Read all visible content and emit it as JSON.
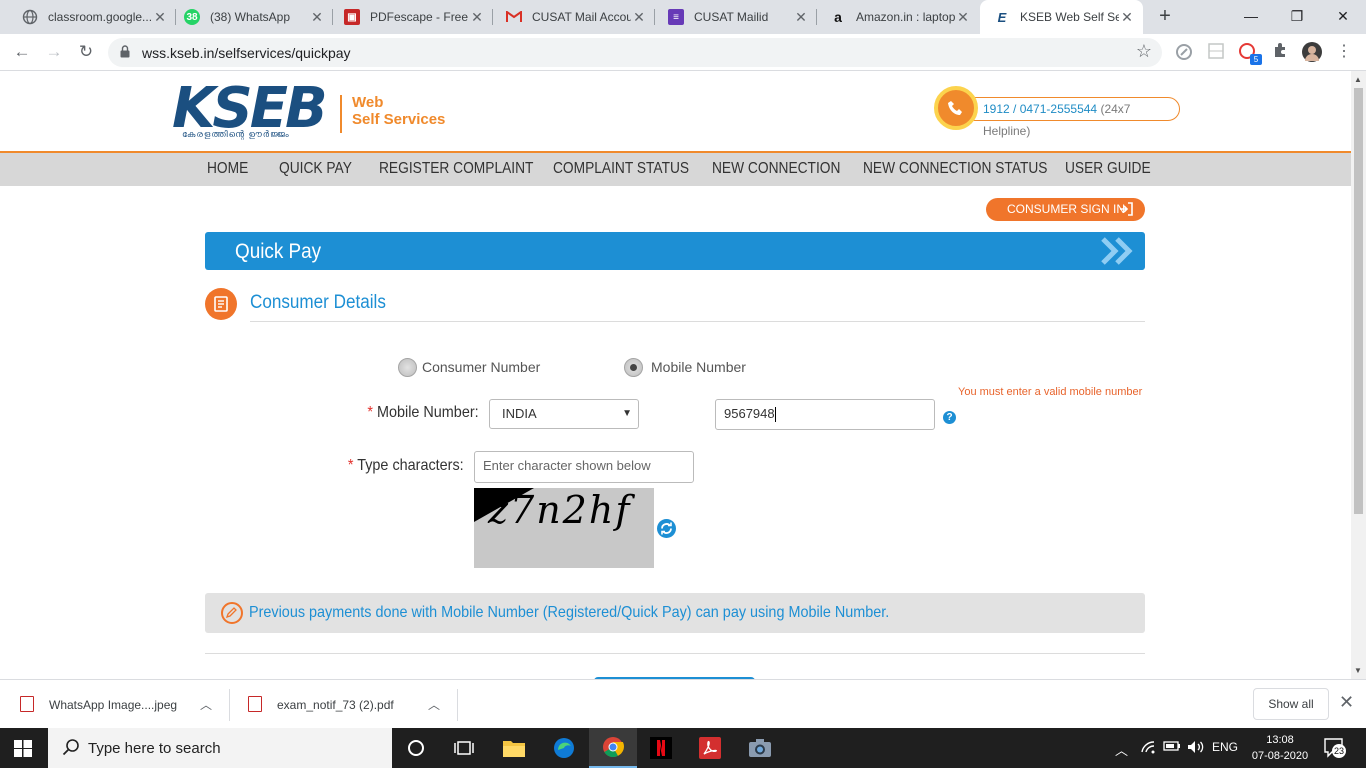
{
  "browser": {
    "tabs": [
      {
        "title": "classroom.google...",
        "icon": "globe-icon"
      },
      {
        "title": "(38) WhatsApp",
        "icon": "whatsapp-icon",
        "badge": "38"
      },
      {
        "title": "PDFescape - Free",
        "icon": "pdfescape-icon"
      },
      {
        "title": "CUSAT Mail Accou",
        "icon": "gmail-icon"
      },
      {
        "title": "CUSAT Mailid",
        "icon": "forms-icon"
      },
      {
        "title": "Amazon.in : laptop",
        "icon": "amazon-icon"
      },
      {
        "title": "KSEB Web Self Ser",
        "icon": "kseb-icon"
      }
    ],
    "url": "wss.kseb.in/selfservices/quickpay",
    "extension_badge": "5"
  },
  "header": {
    "logo_text": "KSEB",
    "logo_tagline": "കേരളത്തിന്റെ ഊർജ്ജം",
    "web_label": "Web",
    "self_services_label": "Self Services",
    "helpline_numbers": "1912 / 0471-2555544",
    "helpline_note": "(24x7 Helpline)"
  },
  "nav": {
    "items": [
      "HOME",
      "QUICK PAY",
      "REGISTER COMPLAINT",
      "COMPLAINT STATUS",
      "NEW CONNECTION",
      "NEW CONNECTION STATUS",
      "USER GUIDE"
    ]
  },
  "signin": {
    "label": "CONSUMER SIGN IN"
  },
  "quickpay": {
    "title": "Quick Pay"
  },
  "consumer_details": {
    "title": "Consumer Details",
    "radio_consumer_number": "Consumer Number",
    "radio_mobile_number": "Mobile Number",
    "selected_option": "Mobile Number",
    "required_mark": "*",
    "mobile_label": "Mobile Number:",
    "country_value": "INDIA",
    "mobile_value": "9567948",
    "error_text": "You must enter a valid mobile number",
    "help_glyph": "?",
    "captcha_label": "Type characters:",
    "captcha_placeholder": "Enter character shown below",
    "captcha_text": "z7n2hf",
    "info_text": "Previous payments done with Mobile Number (Registered/Quick Pay) can pay using Mobile Number."
  },
  "downloads": {
    "items": [
      {
        "name": "WhatsApp Image....jpeg"
      },
      {
        "name": "exam_notif_73 (2).pdf"
      }
    ],
    "show_all": "Show all"
  },
  "taskbar": {
    "search_placeholder": "Type here to search",
    "language": "ENG",
    "time": "13:08",
    "date": "07-08-2020",
    "notification_count": "23"
  },
  "colors": {
    "brand_blue": "#1d8fd4",
    "brand_orange": "#f0752b",
    "kseb_navy": "#1b4f80"
  }
}
